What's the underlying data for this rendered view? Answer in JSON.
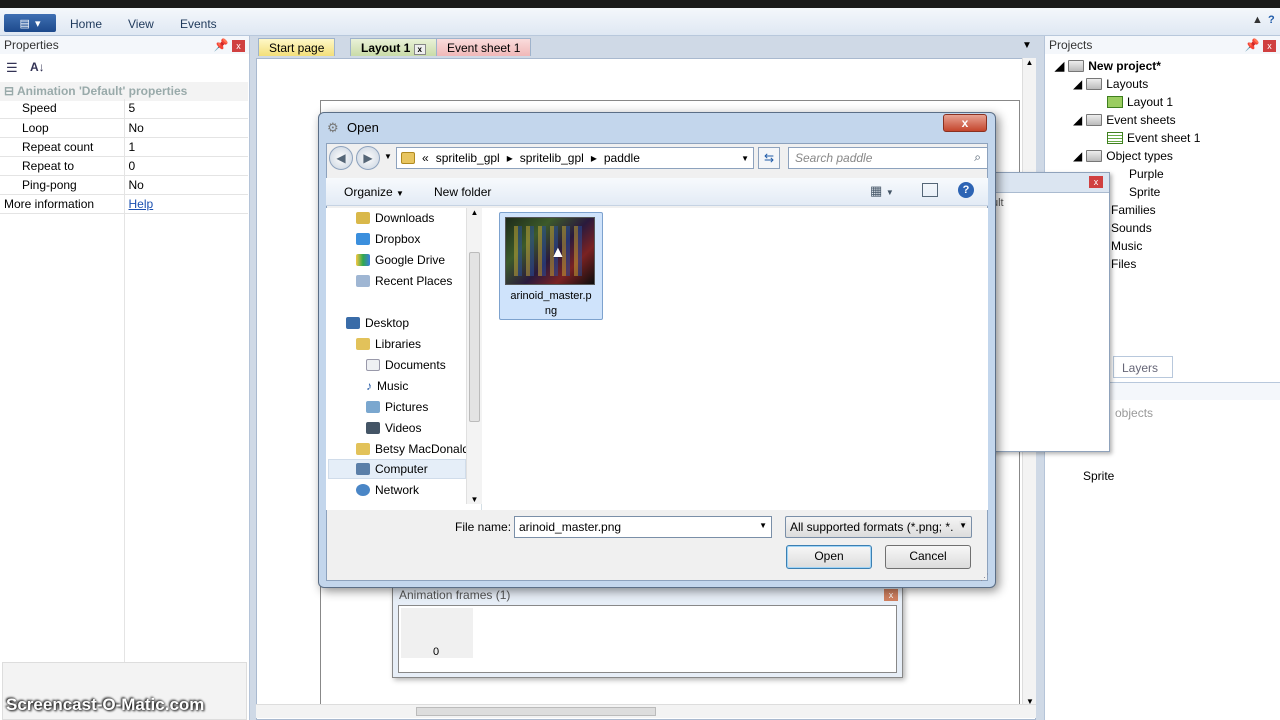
{
  "ribbon": {
    "menu": [
      "Home",
      "View",
      "Events"
    ]
  },
  "properties": {
    "title": "Properties",
    "group": "Animation 'Default' properties",
    "rows": [
      {
        "key": "Speed",
        "value": "5"
      },
      {
        "key": "Loop",
        "value": "No"
      },
      {
        "key": "Repeat count",
        "value": "1"
      },
      {
        "key": "Repeat to",
        "value": "0"
      },
      {
        "key": "Ping-pong",
        "value": "No"
      }
    ],
    "more_label": "More information",
    "more_link": "Help"
  },
  "tabs": [
    "Start page",
    "Layout 1",
    "Event sheet 1"
  ],
  "projects": {
    "title": "Projects",
    "root": "New project*",
    "layouts": "Layouts",
    "layout1": "Layout 1",
    "event_sheets": "Event sheets",
    "event_sheet1": "Event sheet 1",
    "object_types": "Object types",
    "purple": "Purple",
    "sprite": "Sprite",
    "families": "Families",
    "sounds": "Sounds",
    "music": "Music",
    "files": "Files",
    "layers_tab": "Layers",
    "objects_label": "objects",
    "sprite_obj": "Sprite"
  },
  "behind_window": {
    "default_label": "ult"
  },
  "animation_frames": {
    "title": "Animation frames (1)",
    "frame_index": "0"
  },
  "dialog": {
    "title": "Open",
    "path": [
      "spritelib_gpl",
      "spritelib_gpl",
      "paddle"
    ],
    "path_prefix": "«",
    "search_placeholder": "Search paddle",
    "organize": "Organize",
    "new_folder": "New folder",
    "nav_items": {
      "downloads": "Downloads",
      "dropbox": "Dropbox",
      "gdrive": "Google Drive",
      "recent": "Recent Places",
      "desktop": "Desktop",
      "libraries": "Libraries",
      "documents": "Documents",
      "music": "Music",
      "pictures": "Pictures",
      "videos": "Videos",
      "user": "Betsy MacDonald",
      "computer": "Computer",
      "network": "Network"
    },
    "file": {
      "name_line1": "arinoid_master.p",
      "name_line2": "ng"
    },
    "filename_label": "File name:",
    "filename_value": "arinoid_master.png",
    "filetype": "All supported formats (*.png; *.",
    "open_button": "Open",
    "cancel_button": "Cancel"
  },
  "watermark": "Screencast-O-Matic.com"
}
